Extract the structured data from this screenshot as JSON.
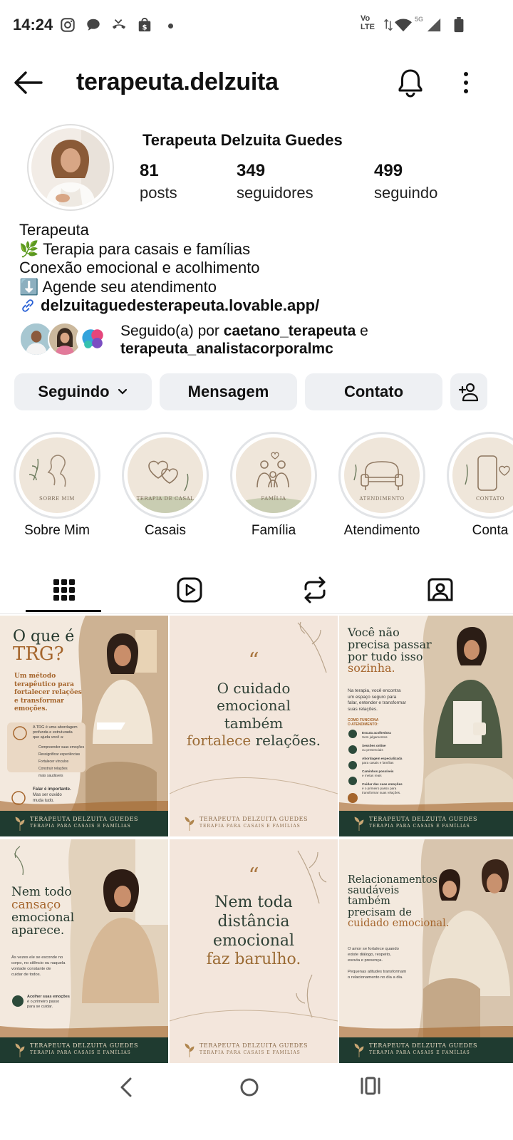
{
  "status_bar": {
    "time": "14:24",
    "left_icons": [
      "instagram-icon",
      "chat-bubble-icon",
      "missed-call-icon",
      "shop-bag-icon"
    ],
    "volte_top": "Vo",
    "volte_bottom": "LTE",
    "network": "5G",
    "right_icons": [
      "data-arrows-icon",
      "wifi-icon",
      "signal-icon",
      "battery-icon"
    ]
  },
  "header": {
    "username": "terapeuta.delzuita",
    "icons": [
      "back-arrow-icon",
      "bell-icon",
      "more-vertical-icon"
    ]
  },
  "profile": {
    "display_name": "Terapeuta Delzuita Guedes",
    "stats": [
      {
        "num": "81",
        "label": "posts"
      },
      {
        "num": "349",
        "label": "seguidores"
      },
      {
        "num": "499",
        "label": "seguindo"
      }
    ],
    "bio": {
      "line1": "Terapeuta",
      "line2_emoji": "🌿",
      "line2": "Terapia para casais e famílias",
      "line3": "Conexão emocional e acolhimento",
      "line4_emoji": "⬇️",
      "line4": "Agende seu atendimento",
      "link": "delzuitaguedesterapeuta.lovable.app/"
    },
    "followed_by": {
      "prefix": "Seguido(a) por ",
      "user1": "caetano_terapeuta",
      "conj": " e",
      "user2": "terapeuta_analistacorporalmc"
    }
  },
  "actions": {
    "following": "Seguindo",
    "message": "Mensagem",
    "contact": "Contato"
  },
  "highlights": [
    {
      "label": "Sobre Mim",
      "caption": "SOBRE MIM"
    },
    {
      "label": "Casais",
      "caption": "TERAPIA DE CASAL"
    },
    {
      "label": "Família",
      "caption": "FAMÍLIA"
    },
    {
      "label": "Atendimento",
      "caption": "ATENDIMENTO"
    },
    {
      "label": "Conta",
      "caption": "CONTATO"
    }
  ],
  "tabs": [
    "grid-icon",
    "reels-icon",
    "reposts-icon",
    "tagged-icon"
  ],
  "posts": {
    "p1": {
      "title1": "O que é",
      "title2": "TRG?",
      "sub1": "Um método",
      "sub2": "terapêutico para",
      "sub3": "fortalecer relações",
      "sub4": "e transformar",
      "sub5": "emoções.",
      "box1": "A TRG é uma abordagem",
      "box2": "profunda e estruturada",
      "box3": "que ajuda você a:",
      "b1": "Compreender suas emoções",
      "b2": "Ressignificar experiências",
      "b3": "Fortalecer vínculos",
      "b4": "Construir relações",
      "b5": "mais saudáveis",
      "note1": "Falar é importante.",
      "note2": "Mas ser ouvido",
      "note3": "muda tudo."
    },
    "p2": {
      "q": "“",
      "l1": "O cuidado",
      "l2": "emocional",
      "l3": "também",
      "l4a": "fortalece",
      "l4b": " relações."
    },
    "p3": {
      "t1": "Você não",
      "t2": "precisa passar",
      "t3": "por tudo isso",
      "t4": "sozinha.",
      "s1": "Na terapia, você encontra",
      "s2": "um espaço seguro para",
      "s3": "falar, entender e transformar",
      "s4": "suas relações.",
      "how1": "COMO FUNCIONA",
      "how2": "O ATENDIMENTO:",
      "i1a": "Escuta acolhedora",
      "i1b": "Sem julgamentos",
      "i2a": "Sessões online",
      "i2b": "ou presenciais",
      "i3a": "Abordagem especializada",
      "i3b": "para casais e famílias",
      "i4a": "Caminhos possíveis",
      "i4b": "e metas reais",
      "i5a": "Cuidar das suas emoções",
      "i5b": "é o primeiro passo para",
      "i5c": "transformar suas relações."
    },
    "p4": {
      "t1": "Nem todo",
      "t2": "cansaço",
      "t3": "emocional",
      "t4": "aparece.",
      "s1": "Às vezes ele se esconde no",
      "s2": "corpo, no silêncio ou naquela",
      "s3": "vontade constante de",
      "s4": "cuidar de todos.",
      "n1": "Acolher suas emoções",
      "n2": "é o primeiro passo",
      "n3": "para se cuidar."
    },
    "p5": {
      "q": "“",
      "l1": "Nem toda",
      "l2": "distância",
      "l3": "emocional",
      "l4": "faz barulho."
    },
    "p6": {
      "t1": "Relacionamentos",
      "t2": "saudáveis",
      "t3": "também",
      "t4": "precisam de",
      "t5": "cuidado emocional.",
      "s1": "O amor se fortalece quando",
      "s2": "existe diálogo, respeito,",
      "s3": "escuta e presença.",
      "s4": "Pequenas atitudes transformam",
      "s5": "o relacionamento no dia a dia."
    },
    "brand": "TERAPEUTA DELZUITA GUEDES",
    "brand_sub": "TERAPIA PARA CASAIS E FAMÍLIAS"
  },
  "navbar": [
    "back-nav-icon",
    "home-nav-icon",
    "recents-nav-icon"
  ],
  "colors": {
    "button_bg": "#eef0f3",
    "tile_beige": "#f3e9de",
    "tile_green": "#1f3b30",
    "tile_accent": "#a5652c"
  }
}
